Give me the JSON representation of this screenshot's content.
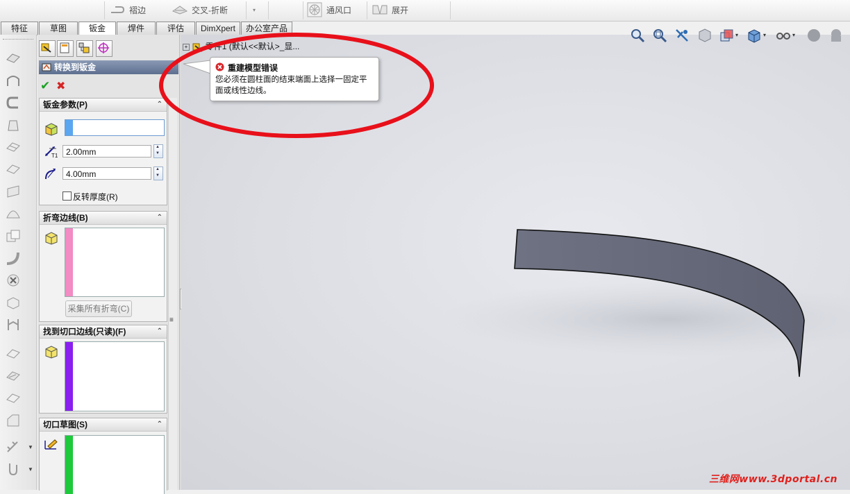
{
  "toolbar": {
    "items": [
      {
        "label": "褶边"
      },
      {
        "label": "交叉-折断"
      },
      {
        "label": "通风口"
      },
      {
        "label": "展开"
      }
    ]
  },
  "tabs": [
    {
      "label": "特征"
    },
    {
      "label": "草图"
    },
    {
      "label": "钣金"
    },
    {
      "label": "焊件"
    },
    {
      "label": "评估"
    },
    {
      "label": "DimXpert"
    },
    {
      "label": "办公室产品"
    }
  ],
  "active_tab": "钣金",
  "feature_tree": {
    "root_label": "零件1  (默认<<默认>_显..."
  },
  "property_manager": {
    "title": "转换到钣金",
    "ok_label": "✔",
    "cancel_label": "✖",
    "sheet_params": {
      "header": "钣金参数(P)",
      "thickness": "2.00mm",
      "thickness_icon_label": "T1",
      "radius": "4.00mm",
      "reverse_label": "反转厚度(R)"
    },
    "bend_edges": {
      "header": "折弯边线(B)",
      "collect_button": "采集所有折弯(C)"
    },
    "rip_edges": {
      "header": "找到切口边线(只读)(F)"
    },
    "rip_sketch": {
      "header": "切口草图(S)"
    }
  },
  "error_tooltip": {
    "title": "重建模型错误",
    "message_line1": "您必须在圆柱面的结束端面上选择一固定平",
    "message_line2": "面或线性边线。"
  },
  "watermark": "三维网www.3dportal.cn",
  "colors": {
    "pm_title_bg": "#6a7b9a",
    "bend_list_bar": "#f38bc4",
    "rip_edge_bar": "#8a1ff0",
    "rip_sketch_bar": "#1ec93c",
    "sel_bar": "#5ba6f0",
    "annotation_circle": "#e8101a",
    "error_icon": "#d9262a",
    "part_face": "#6a6d7e"
  }
}
